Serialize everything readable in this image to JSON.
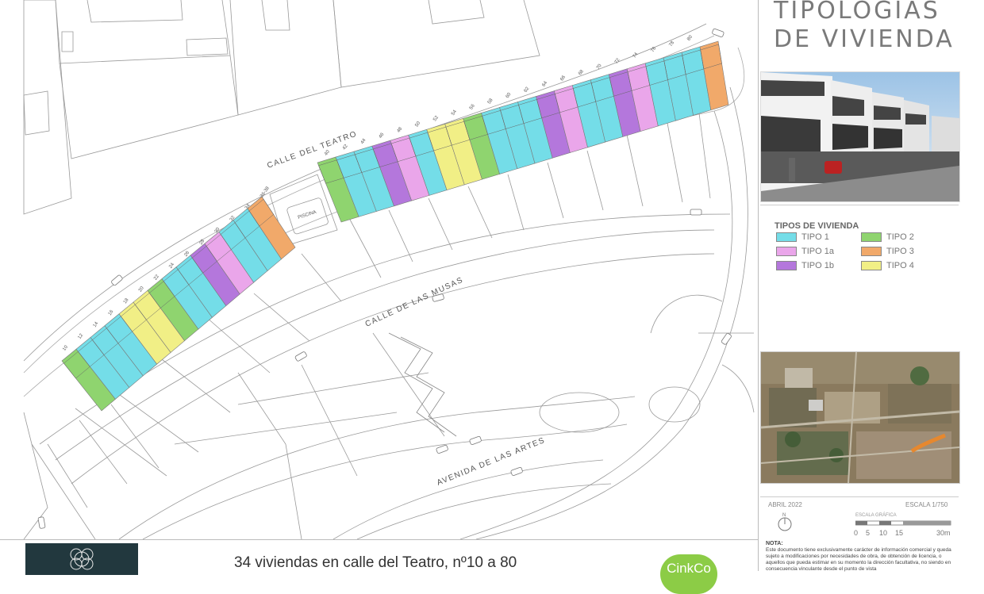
{
  "title": {
    "line1": "TIPOLOGÍAS",
    "line2": "DE VIVIENDA"
  },
  "legend": {
    "heading": "TIPOS DE VIVIENDA",
    "items": [
      {
        "label": "TIPO 1",
        "color": "#74dde8"
      },
      {
        "label": "TIPO 2",
        "color": "#8fd46f"
      },
      {
        "label": "TIPO 1a",
        "color": "#eaa6ea"
      },
      {
        "label": "TIPO 3",
        "color": "#f1a96a"
      },
      {
        "label": "TIPO 1b",
        "color": "#b477dc"
      },
      {
        "label": "TIPO 4",
        "color": "#f1ef86"
      }
    ]
  },
  "streets": {
    "teatro": "CALLE DEL TEATRO",
    "musas": "CALLE DE LAS MUSAS",
    "artes": "AVENIDA DE LAS ARTES",
    "piscina": "PISCINA"
  },
  "house_numbers": [
    "10",
    "12",
    "14",
    "16",
    "18",
    "20",
    "22",
    "24",
    "26",
    "28",
    "30",
    "32",
    "34",
    "36-38",
    "40",
    "42",
    "44",
    "46",
    "48",
    "50",
    "52",
    "54",
    "56",
    "58",
    "60",
    "62",
    "64",
    "66",
    "68",
    "70",
    "72",
    "74",
    "76",
    "78",
    "80"
  ],
  "plots_west": [
    "TIPO 2",
    "TIPO 1",
    "TIPO 1",
    "TIPO 1",
    "TIPO 4",
    "TIPO 4",
    "TIPO 2",
    "TIPO 1",
    "TIPO 1",
    "TIPO 1b",
    "TIPO 1a",
    "TIPO 1",
    "TIPO 1",
    "TIPO 3"
  ],
  "plots_east": [
    "TIPO 2",
    "TIPO 1",
    "TIPO 1",
    "TIPO 1b",
    "TIPO 1a",
    "TIPO 1",
    "TIPO 4",
    "TIPO 4",
    "TIPO 2",
    "TIPO 1",
    "TIPO 1",
    "TIPO 1",
    "TIPO 1b",
    "TIPO 1a",
    "TIPO 1",
    "TIPO 1",
    "TIPO 1b",
    "TIPO 1a",
    "TIPO 1",
    "TIPO 1",
    "TIPO 1",
    "TIPO 3"
  ],
  "info": {
    "date": "ABRIL 2022",
    "scale": "ESCALA  1/750",
    "north": "N",
    "scale_label": "ESCALA GRÁFICA",
    "scale_marks": [
      "0",
      "5",
      "10",
      "15",
      "30m"
    ]
  },
  "note": {
    "heading": "NOTA:",
    "text": "Este documento tiene exclusivamente carácter de información comercial y queda sujeto a modificaciones por necesidades de obra, de obtención de licencia, o aquellos que pueda estimar en su momento la dirección facultativa, no siendo en consecuencia vinculante desde el punto de vista"
  },
  "footer": {
    "headline": "34 viviendas en calle del Teatro,  nº10 a 80",
    "badge": "CinkCo"
  }
}
